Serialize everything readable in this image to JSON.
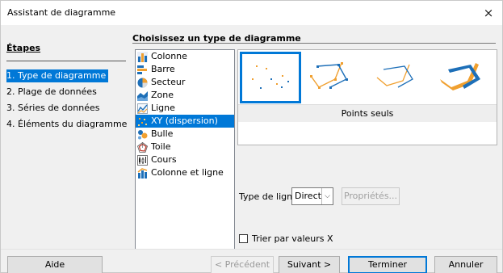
{
  "window": {
    "title": "Assistant de diagramme",
    "close_glyph": "×"
  },
  "steps": {
    "heading": "Étapes",
    "items": [
      {
        "label": "1. Type de diagramme",
        "active": true
      },
      {
        "label": "2. Plage de données",
        "active": false
      },
      {
        "label": "3. Séries de données",
        "active": false
      },
      {
        "label": "4. Éléments du diagramme",
        "active": false
      }
    ]
  },
  "content": {
    "heading": "Choisissez un type de diagramme"
  },
  "chart_types": {
    "items": [
      {
        "label": "Colonne",
        "icon": "column-chart-icon"
      },
      {
        "label": "Barre",
        "icon": "bar-chart-icon"
      },
      {
        "label": "Secteur",
        "icon": "pie-chart-icon"
      },
      {
        "label": "Zone",
        "icon": "area-chart-icon"
      },
      {
        "label": "Ligne",
        "icon": "line-chart-icon"
      },
      {
        "label": "XY (dispersion)",
        "icon": "scatter-chart-icon",
        "selected": true
      },
      {
        "label": "Bulle",
        "icon": "bubble-chart-icon"
      },
      {
        "label": "Toile",
        "icon": "net-chart-icon"
      },
      {
        "label": "Cours",
        "icon": "stock-chart-icon"
      },
      {
        "label": "Colonne et ligne",
        "icon": "column-line-chart-icon"
      }
    ]
  },
  "preview": {
    "selected_caption": "Points seuls",
    "variants": [
      {
        "name": "points-only",
        "selected": true
      },
      {
        "name": "points-and-lines"
      },
      {
        "name": "lines-only"
      },
      {
        "name": "3d-lines"
      }
    ]
  },
  "line_type": {
    "label": "Type de ligne",
    "value": "Direct"
  },
  "properties_button": "Propriétés...",
  "sort_checkbox": {
    "label": "Trier par valeurs X",
    "checked": false
  },
  "buttons": {
    "help": "Aide",
    "prev": "< Précédent",
    "next": "Suivant >",
    "finish": "Terminer",
    "cancel": "Annuler"
  },
  "colors": {
    "accent": "#0078d7",
    "orange": "#f0a030",
    "blue_dot": "#1d6fb8"
  }
}
